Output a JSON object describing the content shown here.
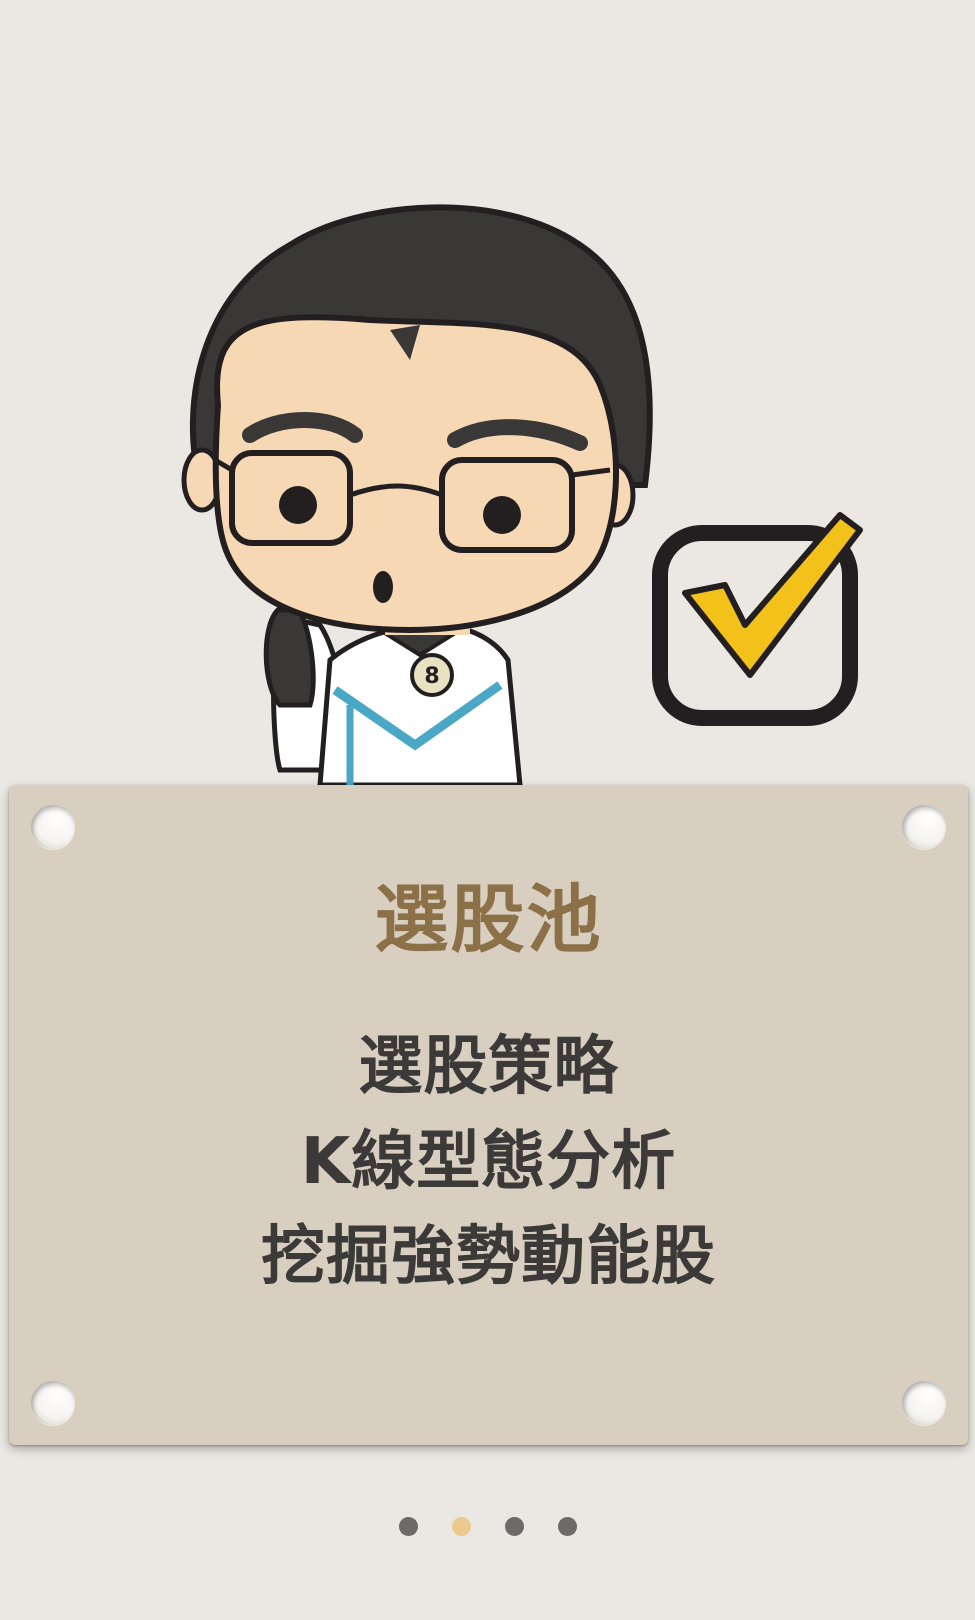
{
  "card": {
    "title": "選股池",
    "lines": [
      "選股策略",
      "K線型態分析",
      "挖掘強勢動能股"
    ]
  },
  "pager": {
    "count": 4,
    "active_index": 1
  },
  "illustration": {
    "character": "cartoon man with glasses holding phone",
    "icon": "yellow checkmark in box"
  },
  "colors": {
    "background": "#ebe7e2",
    "card": "#d9cfc1",
    "title": "#8c7048",
    "text": "#3c3a38",
    "dot": "#6c6b6a",
    "dot_active": "#ecc98e",
    "check": "#f2c21b"
  }
}
